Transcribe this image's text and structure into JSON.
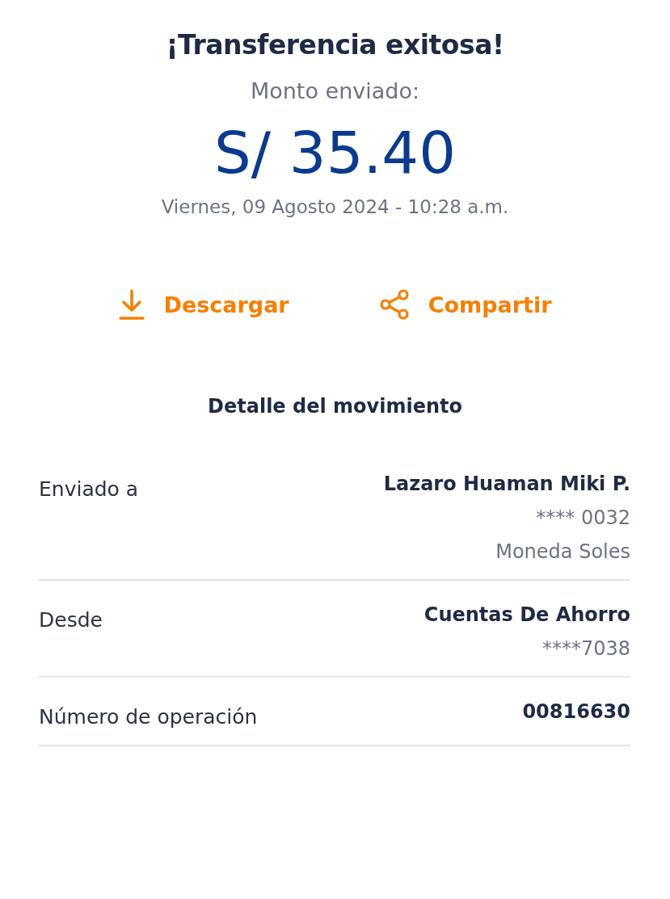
{
  "title": "¡Transferencia exitosa!",
  "amount_label": "Monto enviado:",
  "amount": "S/ 35.40",
  "date": "Viernes, 09 Agosto 2024 - 10:28 a.m.",
  "actions": [
    {
      "kind": "download",
      "label": "Descargar"
    },
    {
      "kind": "share",
      "label": "Compartir"
    }
  ],
  "details_title": "Detalle del movimiento",
  "details": [
    {
      "label": "Enviado a",
      "lines": [
        {
          "kind": "primary",
          "text": "Lazaro Huaman Miki P."
        },
        {
          "kind": "secondary",
          "text": "**** 0032"
        },
        {
          "kind": "secondary",
          "text": "Moneda Soles"
        }
      ]
    },
    {
      "label": "Desde",
      "lines": [
        {
          "kind": "primary",
          "text": "Cuentas De Ahorro"
        },
        {
          "kind": "secondary",
          "text": "****7038"
        }
      ]
    },
    {
      "label": "Número de operación",
      "lines": [
        {
          "kind": "primary",
          "text": "00816630"
        }
      ]
    }
  ]
}
